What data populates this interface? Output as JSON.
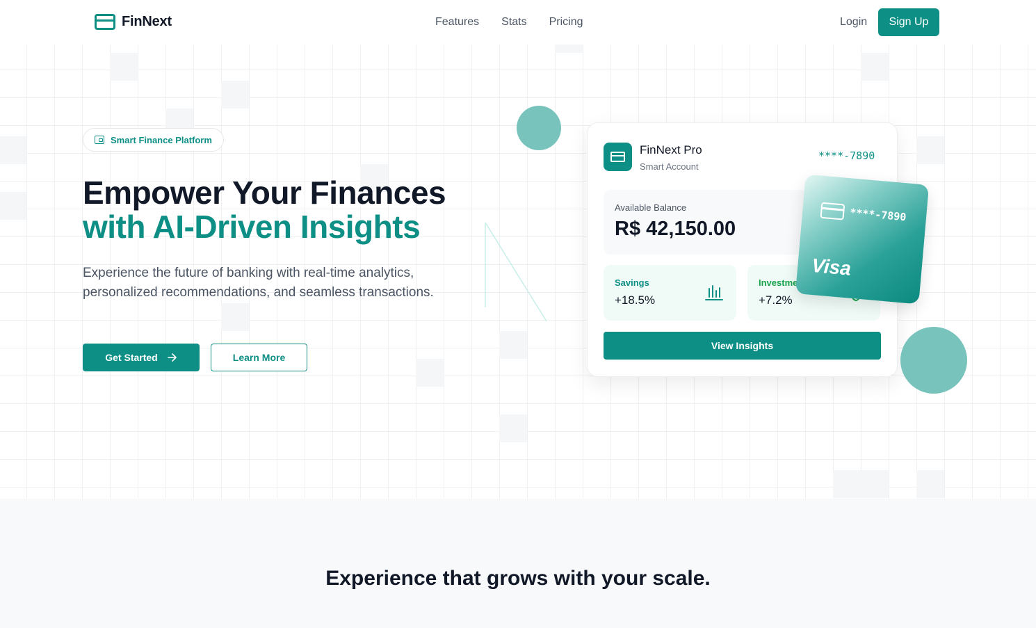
{
  "nav": {
    "brand": "FinNext",
    "links": [
      "Features",
      "Stats",
      "Pricing"
    ],
    "login": "Login",
    "signup": "Sign Up"
  },
  "hero": {
    "badge": "Smart Finance Platform",
    "headline_line1": "Empower Your Finances",
    "headline_line2": "with AI-Driven Insights",
    "description": "Experience the future of banking with real-time analytics, personalized recommendations, and seamless transactions.",
    "primary_button": "Get Started",
    "secondary_button": "Learn More"
  },
  "account_card": {
    "title": "FinNext Pro",
    "subtitle": "Smart Account",
    "card_number": "****-7890",
    "balance_label": "Available Balance",
    "balance_value": "R$ 42,150.00",
    "savings_label": "Savings",
    "savings_value": "+18.5%",
    "investments_label": "Investments",
    "investments_value": "+7.2%",
    "button": "View Insights"
  },
  "visa_card": {
    "number": "****-7890",
    "brand": "Visa"
  },
  "section": {
    "title": "Experience that grows with your scale."
  },
  "colors": {
    "accent": "#0d8f86",
    "accent_light": "#79c3bd",
    "text_dark": "#111827",
    "text_muted": "#4b5563"
  }
}
